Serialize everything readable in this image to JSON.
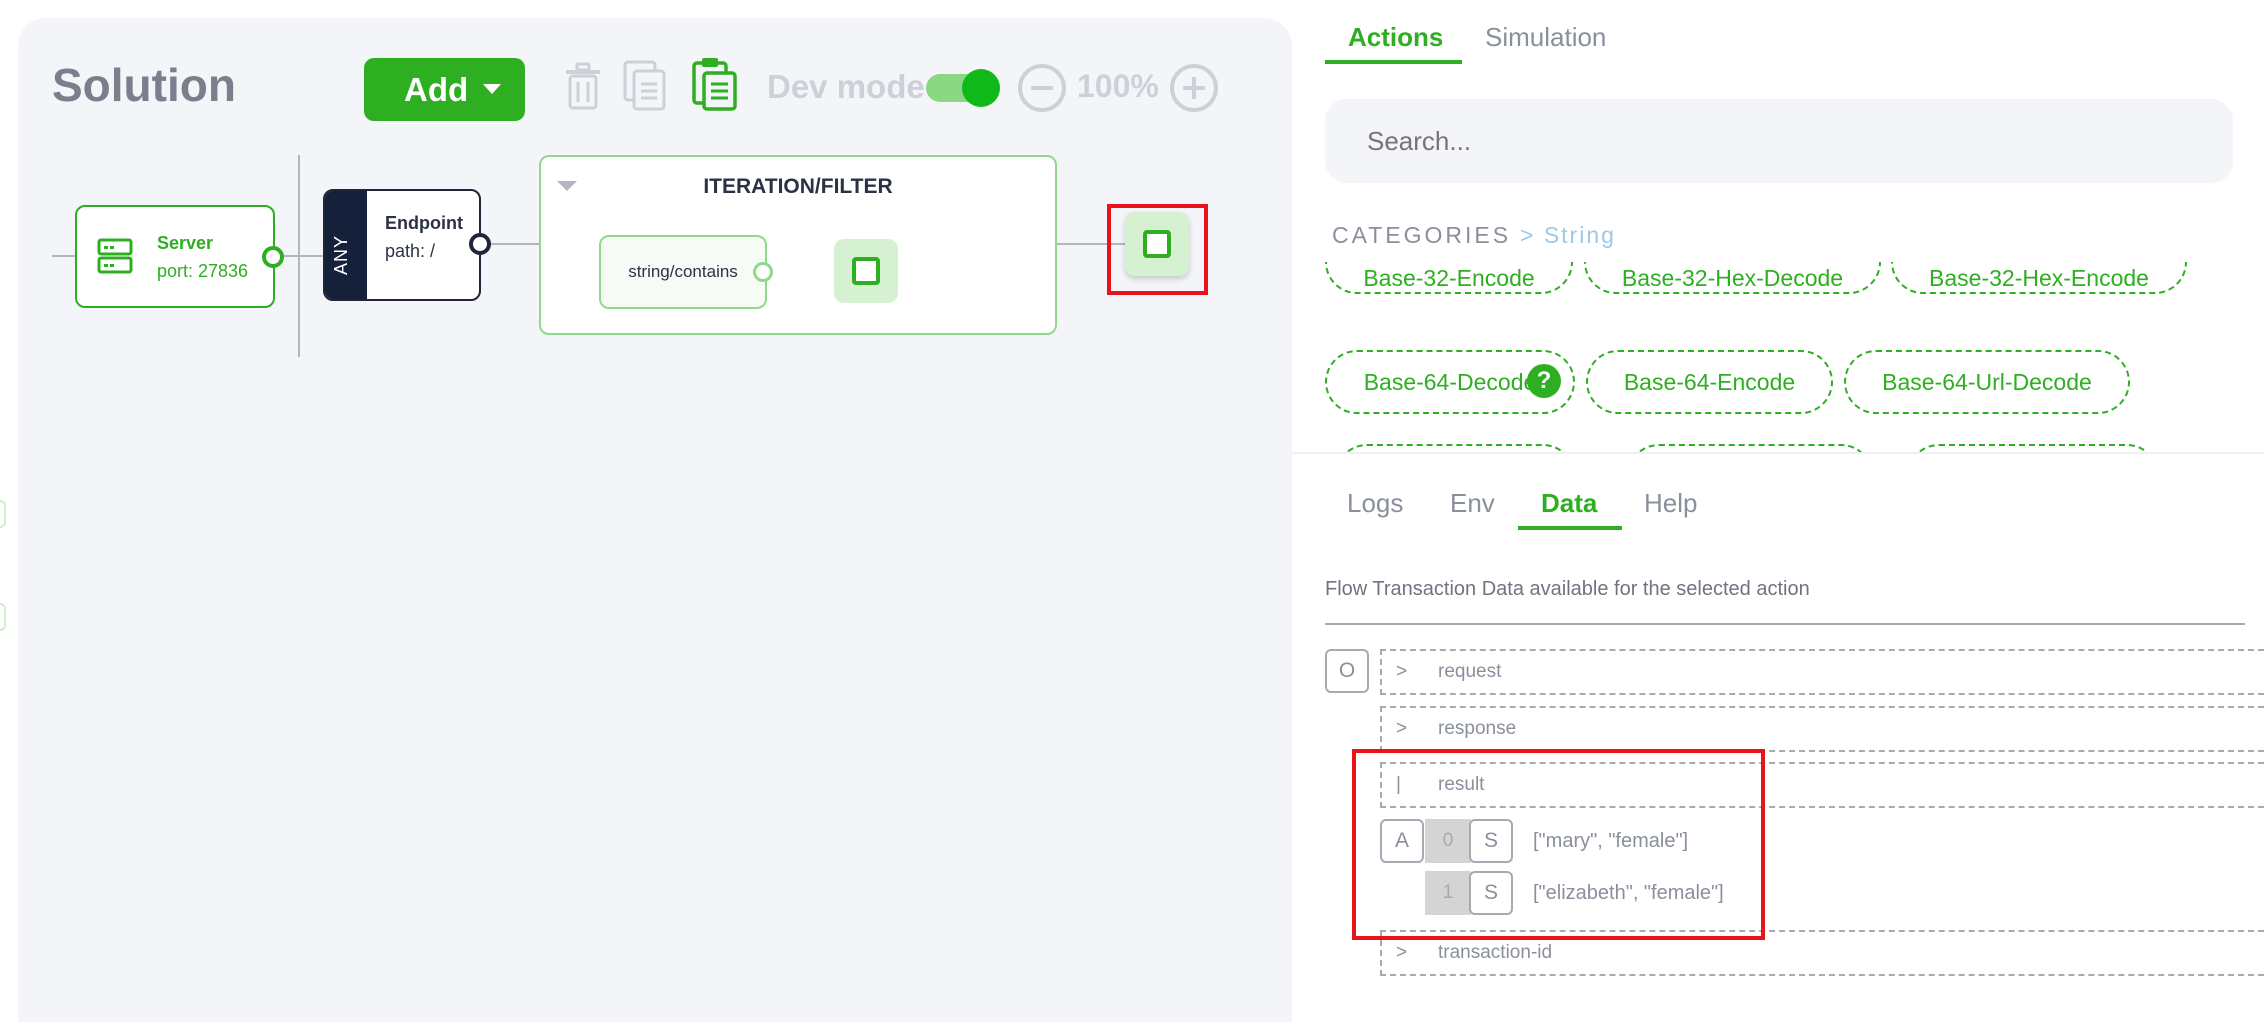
{
  "canvas": {
    "title": "Solution",
    "add_label": "Add",
    "devmode_label": "Dev mode",
    "devmode_on": true,
    "zoom": "100%"
  },
  "nodes": {
    "server": {
      "title": "Server",
      "port": "port: 27836"
    },
    "endpoint": {
      "method": "ANY",
      "title": "Endpoint",
      "path": "path: /"
    },
    "iteration": {
      "title": "ITERATION/FILTER",
      "inner": "string/contains"
    }
  },
  "tabs_top": [
    {
      "label": "Actions",
      "active": true
    },
    {
      "label": "Simulation",
      "active": false
    }
  ],
  "search": {
    "placeholder": "Search..."
  },
  "categories": {
    "label": "CATEGORIES",
    "crumb": "> String",
    "chips": [
      "Base-32-Encode",
      "Base-32-Hex-Decode",
      "Base-32-Hex-Encode",
      "Base-64-Decode",
      "Base-64-Encode",
      "Base-64-Url-Decode"
    ]
  },
  "tabs_bottom": [
    {
      "label": "Logs",
      "active": false
    },
    {
      "label": "Env",
      "active": false
    },
    {
      "label": "Data",
      "active": true
    },
    {
      "label": "Help",
      "active": false
    }
  ],
  "data_panel": {
    "description": "Flow Transaction Data available for the selected action",
    "object_badge": "O",
    "rows": [
      {
        "symbol": ">",
        "key": "request"
      },
      {
        "symbol": ">",
        "key": "response"
      },
      {
        "symbol": "|",
        "key": "result"
      },
      {
        "symbol": ">",
        "key": "transaction-id"
      }
    ],
    "array_badge": "A",
    "string_badge": "S",
    "items": [
      {
        "index": "0",
        "value": "[\"mary\", \"female\"]"
      },
      {
        "index": "1",
        "value": "[\"elizabeth\", \"female\"]"
      }
    ]
  },
  "colors": {
    "accent": "#2eaf21",
    "highlight": "#e8131b",
    "canvas_bg": "#f4f5f8"
  }
}
